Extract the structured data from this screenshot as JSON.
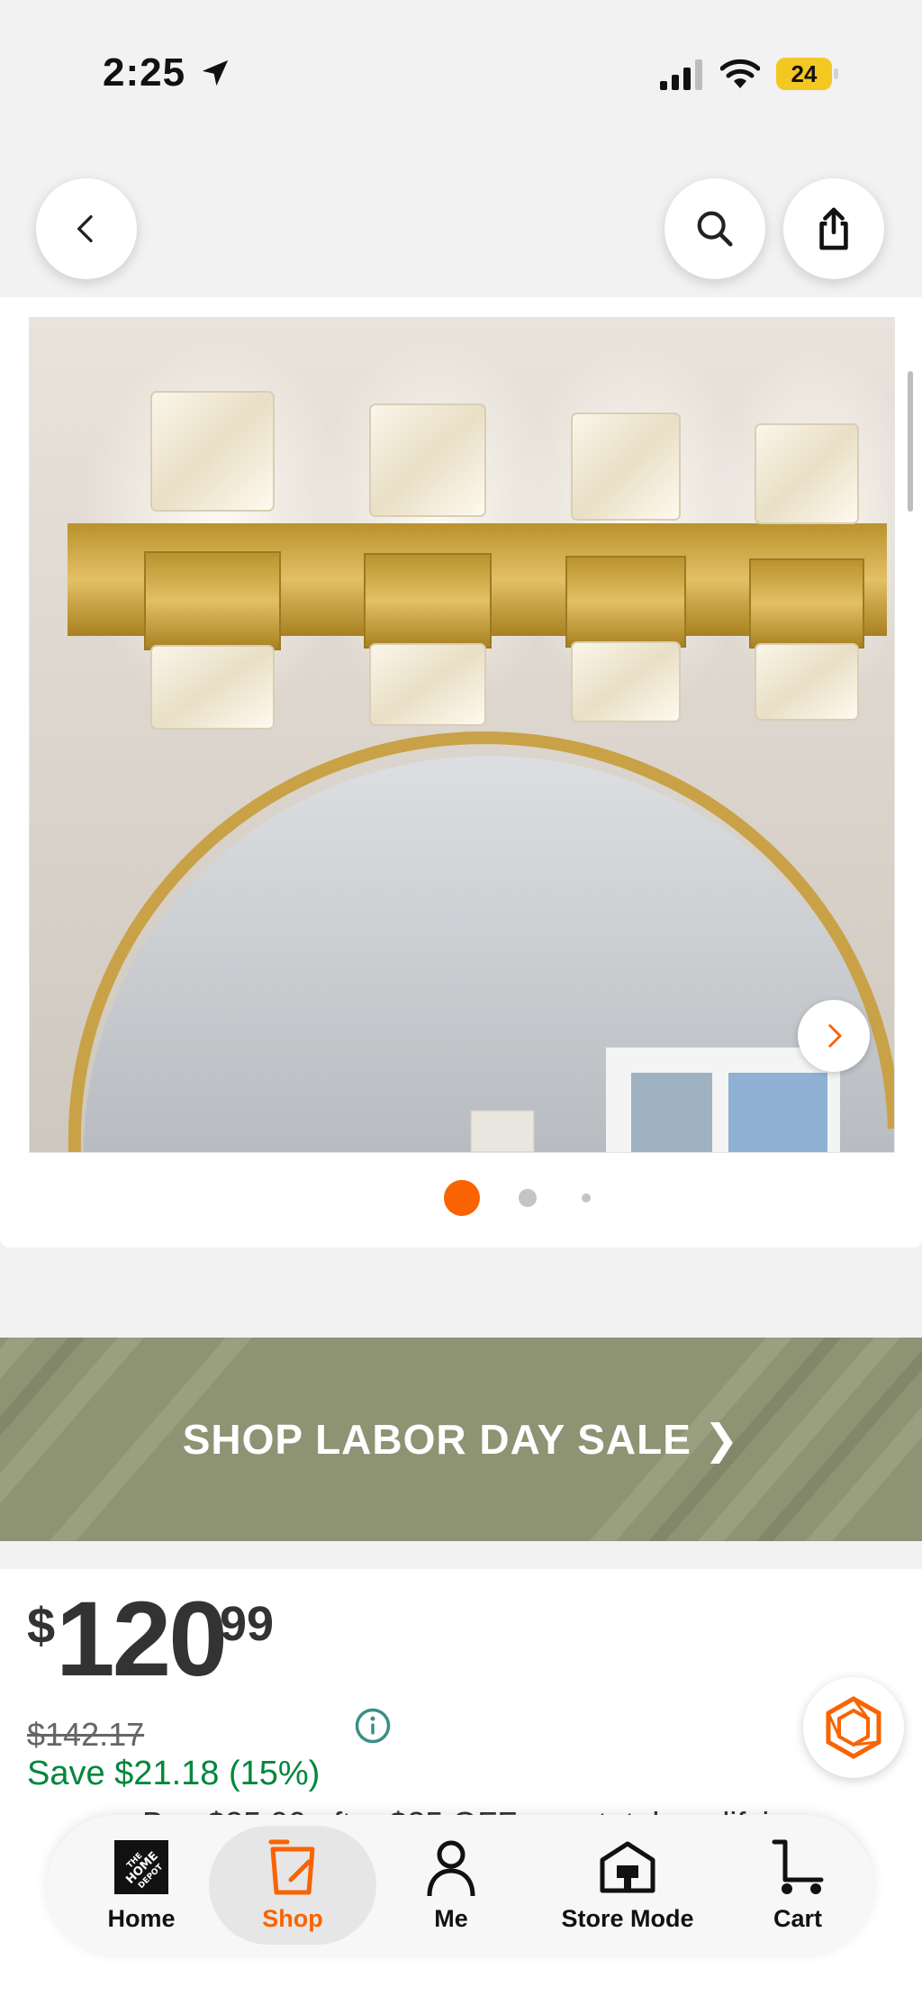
{
  "status_bar": {
    "time": "2:25",
    "battery": "24",
    "location_icon": "location-arrow-icon",
    "signal_icon": "cellular-signal-icon",
    "wifi_icon": "wifi-icon"
  },
  "top_bar": {
    "back_icon": "chevron-left-icon",
    "search_icon": "search-icon",
    "share_icon": "share-icon"
  },
  "gallery": {
    "image_alt": "Gold bathroom vanity light with four crystal shades above a round mirror",
    "next_icon": "chevron-right-icon",
    "dots_count": 3,
    "active_dot": 1
  },
  "promo": {
    "label": "SHOP LABOR DAY SALE ❯",
    "background": "#8d9373"
  },
  "price": {
    "currency": "$",
    "whole": "120",
    "cents": "99",
    "was": "$142.17",
    "save": "Save $21.18 (15%)",
    "partial_line": "Buy $25.00 after $25 OFF on a total qualifying"
  },
  "bottom_nav": {
    "items": [
      {
        "label": "Home",
        "icon": "home-depot-logo-icon"
      },
      {
        "label": "Shop",
        "icon": "shop-bucket-icon"
      },
      {
        "label": "Me",
        "icon": "person-icon"
      },
      {
        "label": "Store Mode",
        "icon": "store-icon"
      },
      {
        "label": "Cart",
        "icon": "cart-icon"
      }
    ],
    "active": "Shop"
  },
  "colors": {
    "brand_orange": "#f96302",
    "save_green": "#00873c",
    "info_teal": "#3a8f86"
  }
}
